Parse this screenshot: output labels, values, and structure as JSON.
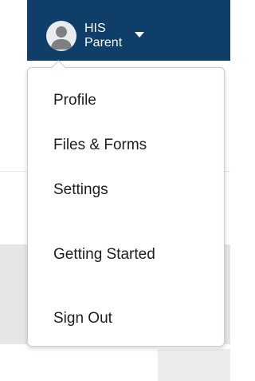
{
  "header": {
    "user": {
      "line1": "HIS",
      "line2": "Parent",
      "avatar_icon": "user-avatar-icon",
      "caret_icon": "caret-down-icon"
    },
    "brand_color": "#0f3e68"
  },
  "menu": {
    "items": [
      {
        "label": "Profile"
      },
      {
        "label": "Files & Forms"
      },
      {
        "label": "Settings"
      },
      {
        "label": "Getting Started"
      },
      {
        "label": "Sign Out"
      }
    ]
  }
}
